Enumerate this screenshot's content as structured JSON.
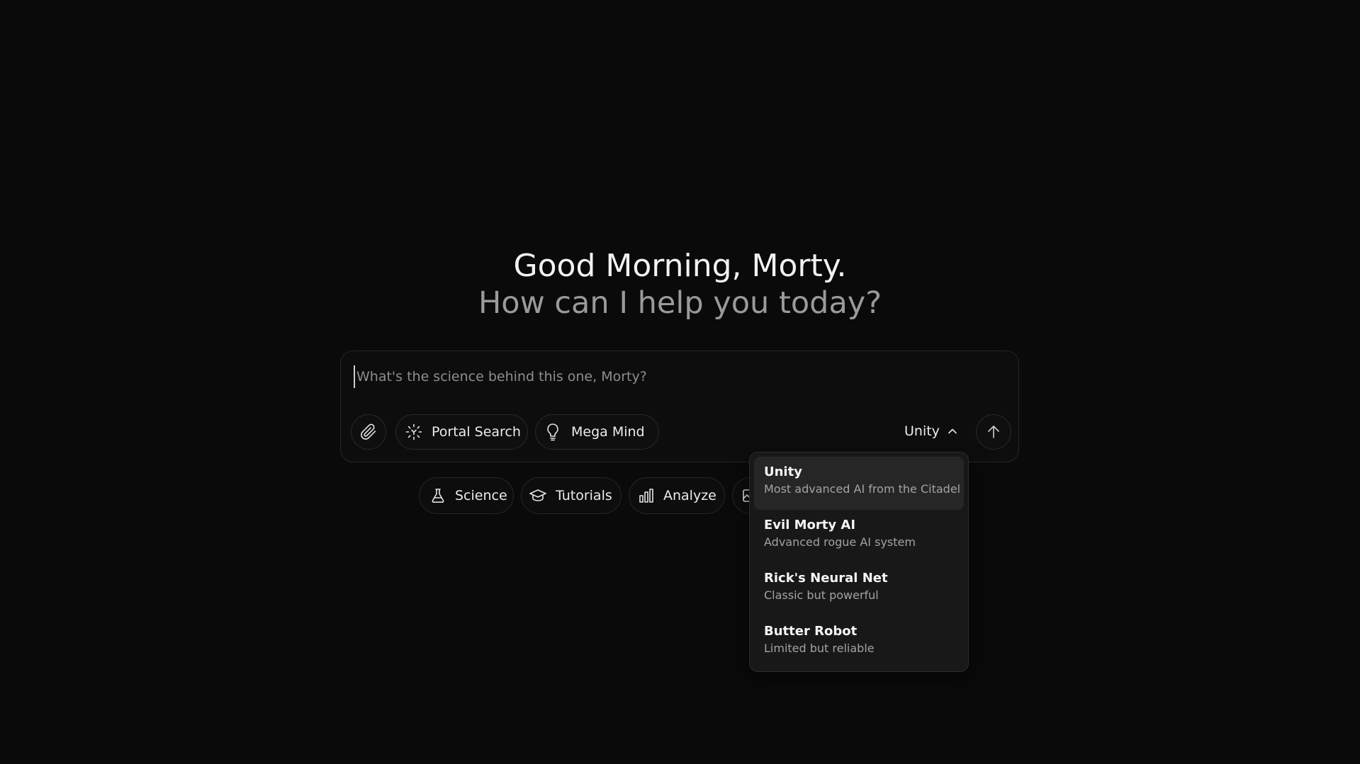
{
  "greeting": {
    "title": "Good Morning, Morty.",
    "subtitle": "How can I help you today?"
  },
  "composer": {
    "placeholder": "What's the science behind this one, Morty?",
    "value": "",
    "attach_icon": "paperclip-icon",
    "tools": [
      {
        "label": "Portal Search",
        "icon": "portal-scan-icon"
      },
      {
        "label": "Mega Mind",
        "icon": "lightbulb-icon"
      }
    ],
    "model_selected": "Unity",
    "model_chevron_icon": "chevron-up-icon",
    "send_icon": "arrow-up-icon"
  },
  "suggestions": [
    {
      "label": "Science",
      "icon": "flask-icon"
    },
    {
      "label": "Tutorials",
      "icon": "graduation-cap-icon"
    },
    {
      "label": "Analyze",
      "icon": "bar-chart-icon"
    },
    {
      "label": "",
      "icon": "image-icon"
    }
  ],
  "model_menu": {
    "items": [
      {
        "name": "Unity",
        "description": "Most advanced AI from the Citadel",
        "selected": true
      },
      {
        "name": "Evil Morty AI",
        "description": "Advanced rogue AI system",
        "selected": false
      },
      {
        "name": "Rick's Neural Net",
        "description": "Classic but powerful",
        "selected": false
      },
      {
        "name": "Butter Robot",
        "description": "Limited but reliable",
        "selected": false
      }
    ]
  },
  "colors": {
    "background": "#0a0a0a",
    "menu_background": "#181818",
    "menu_selected": "#262626",
    "border": "#2a2a2a",
    "text": "#ededed",
    "muted_text": "#9a9a9a"
  }
}
